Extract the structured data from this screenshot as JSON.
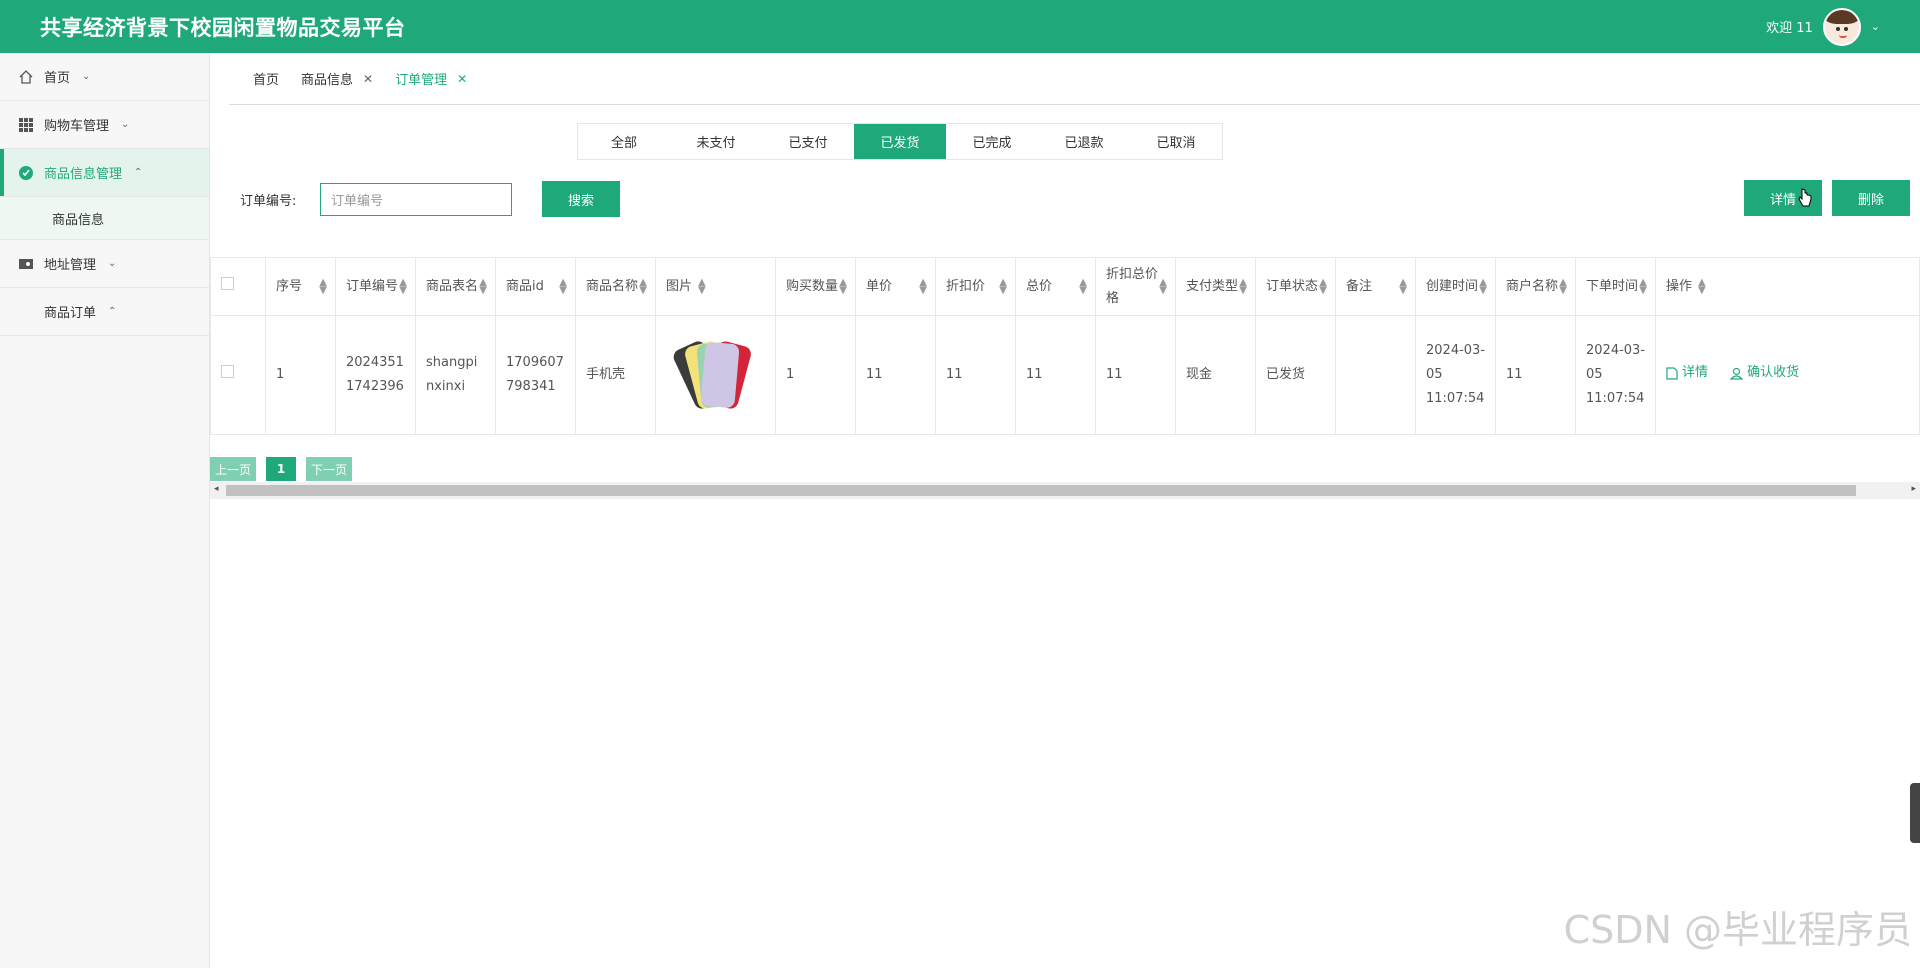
{
  "header": {
    "title": "共享经济背景下校园闲置物品交易平台",
    "welcome": "欢迎 11"
  },
  "sidebar": {
    "items": [
      {
        "label": "首页",
        "icon": "home-icon"
      },
      {
        "label": "购物车管理",
        "icon": "grid-icon"
      },
      {
        "label": "商品信息管理",
        "icon": "check-circle-icon",
        "sub": "商品信息"
      },
      {
        "label": "地址管理",
        "icon": "wallet-icon"
      },
      {
        "label": "商品订单",
        "icon": ""
      }
    ]
  },
  "tabs": [
    {
      "label": "首页"
    },
    {
      "label": "商品信息"
    },
    {
      "label": "订单管理"
    }
  ],
  "status_tabs": [
    "全部",
    "未支付",
    "已支付",
    "已发货",
    "已完成",
    "已退款",
    "已取消"
  ],
  "search": {
    "label": "订单编号:",
    "placeholder": "订单编号",
    "button": "搜索"
  },
  "actions": {
    "detail": "详情",
    "delete": "删除"
  },
  "table": {
    "headers": [
      "序号",
      "订单编号",
      "商品表名",
      "商品id",
      "商品名称",
      "图片",
      "购买数量",
      "单价",
      "折扣价",
      "总价",
      "折扣总价格",
      "支付类型",
      "订单状态",
      "备注",
      "创建时间",
      "商户名称",
      "下单时间",
      "操作"
    ],
    "rows": [
      {
        "no": "1",
        "order_no": "20243511742396",
        "table_name": "shangpinxinxi",
        "product_id": "1709607798341",
        "name": "手机壳",
        "qty": "1",
        "price": "11",
        "discount": "11",
        "total": "11",
        "discount_total": "11",
        "pay_type": "现金",
        "status": "已发货",
        "remark": "",
        "created": "2024-03-05 11:07:54",
        "merchant": "11",
        "order_time": "2024-03-05 11:07:54",
        "op_detail": "详情",
        "op_confirm": "确认收货"
      }
    ]
  },
  "pager": {
    "prev": "上一页",
    "current": "1",
    "next": "下一页"
  },
  "watermark": "CSDN @毕业程序员",
  "colors": {
    "accent": "#1fa97a"
  }
}
